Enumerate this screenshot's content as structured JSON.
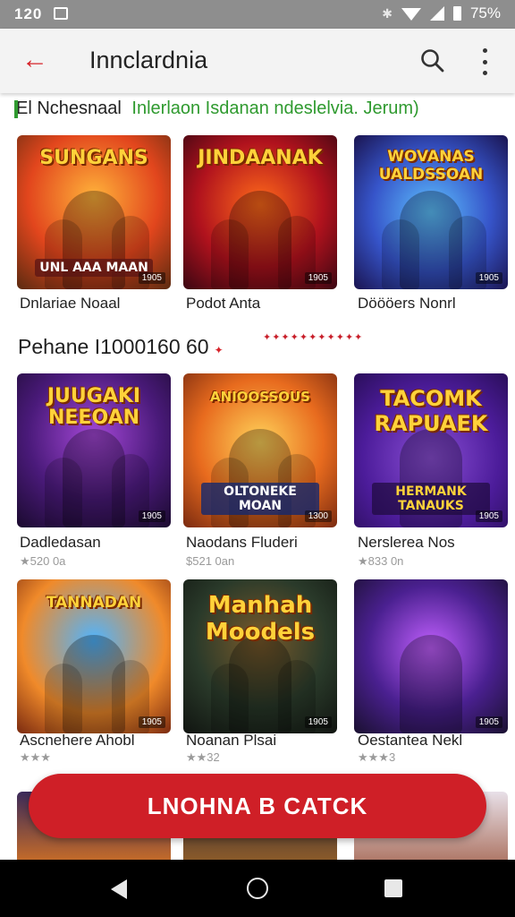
{
  "status_bar": {
    "time": "120",
    "battery": "75%"
  },
  "app_bar": {
    "title": "Innclardnia"
  },
  "section1": {
    "heading": "El Nchesnaal",
    "subheading": "Inlerlaon Isdanan ndeslelvia. Jerum)"
  },
  "section2": {
    "heading": "Pehane I1000160 60",
    "mark": "✦"
  },
  "rows": [
    {
      "games": [
        {
          "art_title": "SUNGANS",
          "art_banner": "UNL AAA MAAN",
          "badge": "1905",
          "name": "Dnlariae Noaal",
          "meta": ""
        },
        {
          "art_title": "JINDAANAK",
          "art_banner": "",
          "badge": "1905",
          "name": "Podot Anta",
          "meta": ""
        },
        {
          "art_title": "WOVANAS UALDSSOAN",
          "art_banner": "",
          "badge": "1905",
          "name": "Döööers Nonrl",
          "meta": ""
        }
      ]
    },
    {
      "games": [
        {
          "art_title": "JUUGAKI NEEOAN",
          "art_banner": "",
          "badge": "1905",
          "name": "Dadledasan",
          "meta": "★520 0a"
        },
        {
          "art_title": "ANIOOSSOUS",
          "art_banner": "OLTONEKE MOAN",
          "badge": "1300",
          "name": "Naodans Fluderi",
          "meta": "$521 0an"
        },
        {
          "art_title": "TACOMK RAPUAEK",
          "art_banner": "HERMANK TANAUKS",
          "badge": "1905",
          "name": "Nerslerea Nos",
          "meta": "★833 0n"
        }
      ]
    },
    {
      "games": [
        {
          "art_title": "TANNADAN",
          "art_banner": "",
          "badge": "1905",
          "name": "Ascnehere Ahobl",
          "meta": "★★★"
        },
        {
          "art_title": "Manhah Moodels",
          "art_banner": "",
          "badge": "1905",
          "name": "Noanan Plsai",
          "meta": "★★32"
        },
        {
          "art_title": "",
          "art_banner": "",
          "badge": "1905",
          "name": "Oestantea Nekl",
          "meta": "★★★3"
        }
      ]
    }
  ],
  "cta": {
    "label": "LNOHNA B CATCK"
  },
  "colors": {
    "accent": "#d6232a",
    "cta": "#cf1f27",
    "green": "#2f9a2f"
  }
}
